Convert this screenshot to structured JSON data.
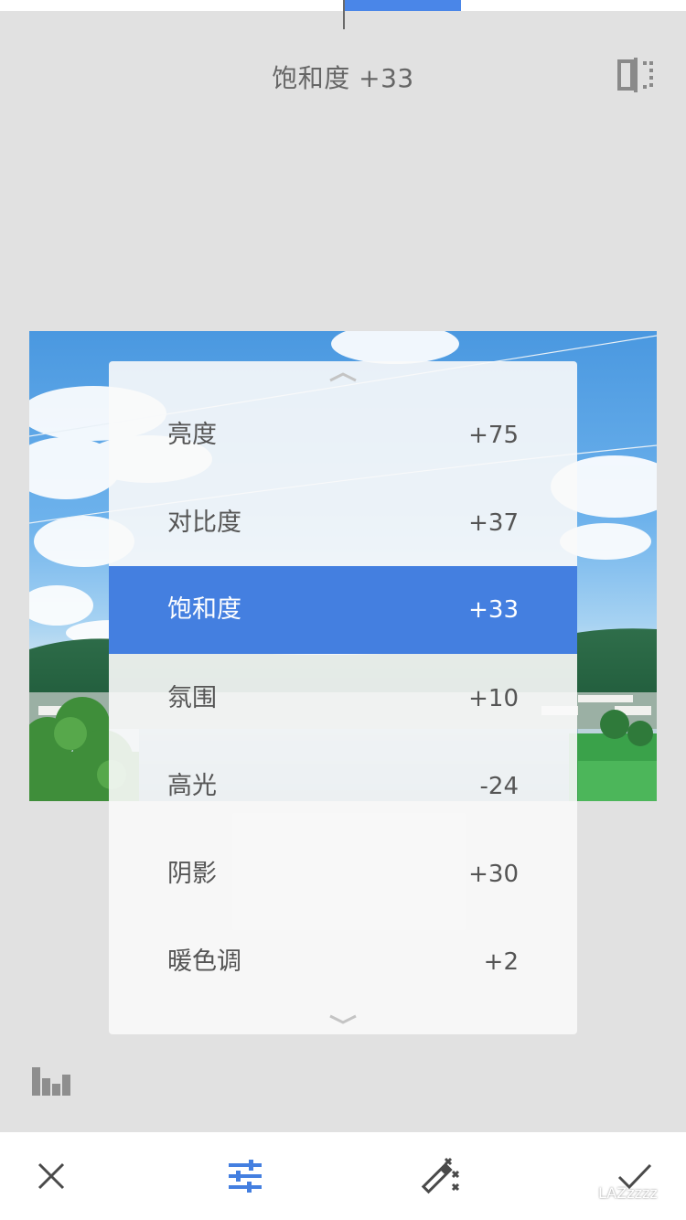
{
  "top_slider": {
    "value_fraction": 0.17
  },
  "header": {
    "title": "饱和度 +33",
    "compare_icon": "compare-split-icon"
  },
  "menu": {
    "up_icon": "chevron-up-icon",
    "down_icon": "chevron-down-icon",
    "items": [
      {
        "label": "亮度",
        "value": "+75",
        "active": false
      },
      {
        "label": "对比度",
        "value": "+37",
        "active": false
      },
      {
        "label": "饱和度",
        "value": "+33",
        "active": true
      },
      {
        "label": "氛围",
        "value": "+10",
        "active": false
      },
      {
        "label": "高光",
        "value": "-24",
        "active": false
      },
      {
        "label": "阴影",
        "value": "+30",
        "active": false
      },
      {
        "label": "暖色调",
        "value": "+2",
        "active": false
      }
    ]
  },
  "histogram_icon": "histogram-icon",
  "toolbar": {
    "cancel_icon": "close-icon",
    "adjust_icon": "sliders-icon",
    "auto_icon": "magic-wand-icon",
    "apply_icon": "checkmark-icon"
  },
  "watermark": {
    "text": "LAZzzzz"
  },
  "colors": {
    "accent": "#447fe0",
    "background": "#e1e1e1",
    "toolbar": "#ffffff",
    "text": "#555555"
  }
}
